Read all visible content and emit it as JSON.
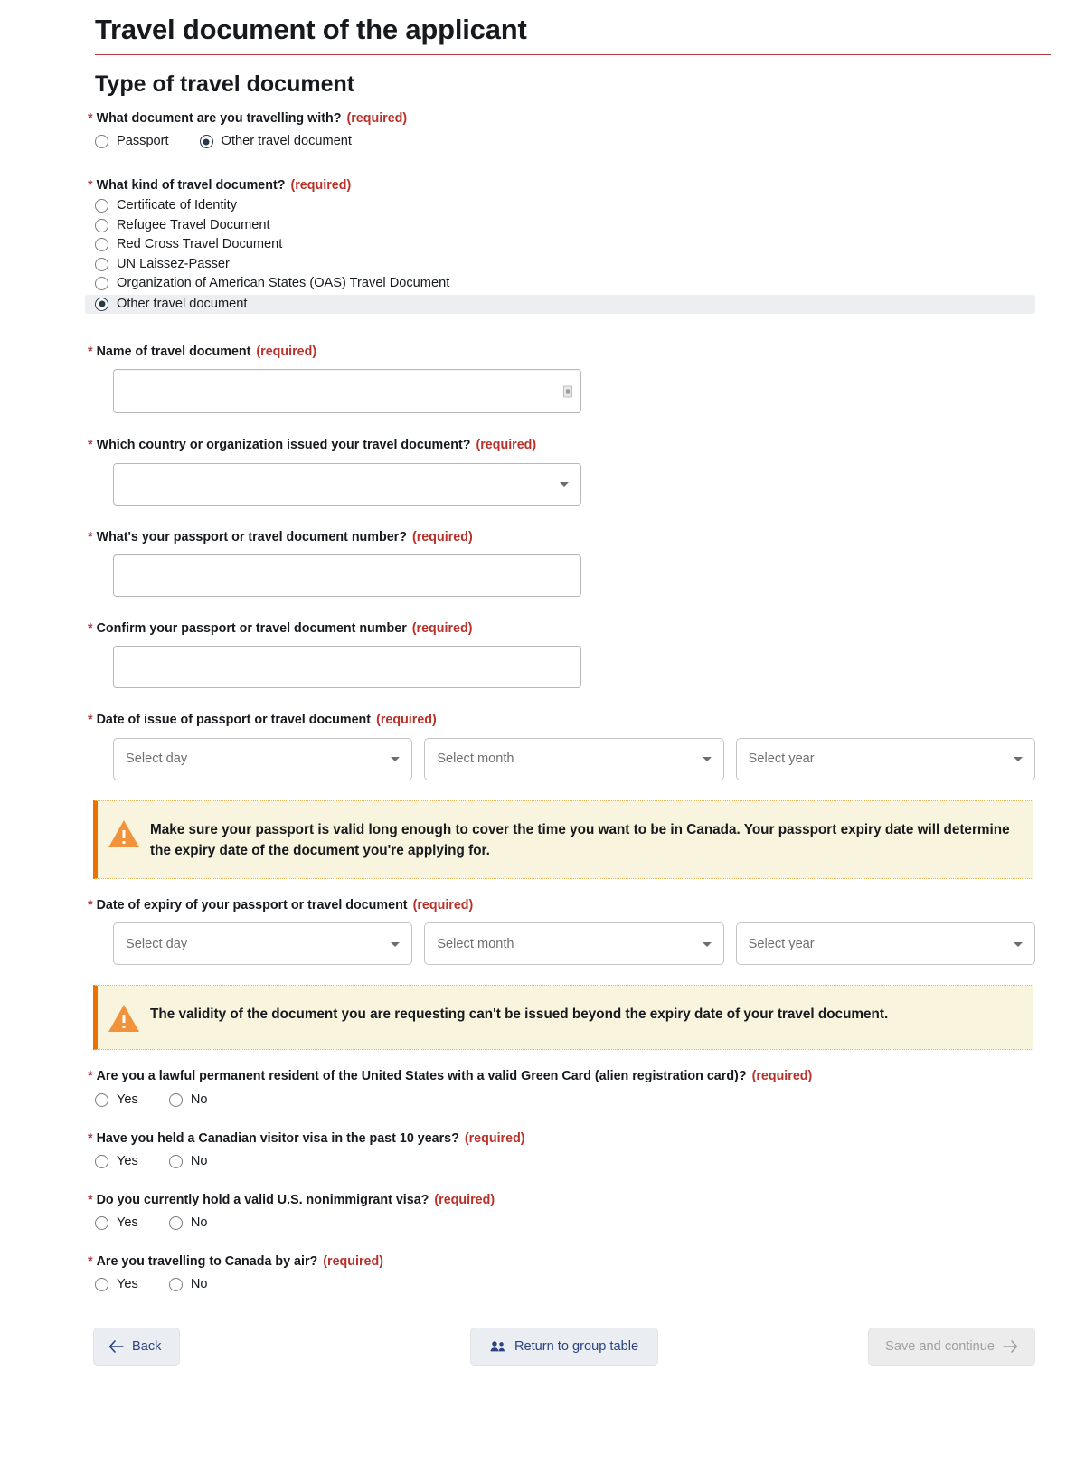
{
  "page": {
    "title": "Travel document of the applicant",
    "section_title": "Type of travel document",
    "required_tag": "(required)",
    "accent_color": "#af3c43",
    "required_color": "#b8322b",
    "alert_bg": "#f9f4dd",
    "alert_border": "#ee7100"
  },
  "q_doc_type": {
    "label": "What document are you travelling with?",
    "options": [
      {
        "label": "Passport",
        "checked": false
      },
      {
        "label": "Other travel document",
        "checked": true
      }
    ]
  },
  "q_doc_kind": {
    "label": "What kind of travel document?",
    "options": [
      {
        "label": "Certificate of Identity",
        "checked": false
      },
      {
        "label": "Refugee Travel Document",
        "checked": false
      },
      {
        "label": "Red Cross Travel Document",
        "checked": false
      },
      {
        "label": "UN Laissez-Passer",
        "checked": false
      },
      {
        "label": "Organization of American States (OAS) Travel Document",
        "checked": false
      },
      {
        "label": "Other travel document",
        "checked": true
      }
    ]
  },
  "q_doc_name": {
    "label": "Name of travel document",
    "value": "",
    "placeholder": ""
  },
  "q_issuer": {
    "label": "Which country or organization issued your travel document?",
    "selected": "",
    "placeholder": ""
  },
  "q_doc_number": {
    "label": "What's your passport or travel document number?",
    "value": "",
    "placeholder": ""
  },
  "q_doc_number_confirm": {
    "label": "Confirm your passport or travel document number",
    "value": "",
    "placeholder": ""
  },
  "q_date_issue": {
    "label": "Date of issue of passport or travel document",
    "day_placeholder": "Select day",
    "month_placeholder": "Select month",
    "year_placeholder": "Select year"
  },
  "alert_issue": {
    "text": "Make sure your passport is valid long enough to cover the time you want to be in Canada. Your passport expiry date will determine the expiry date of the document you're applying for."
  },
  "q_date_expiry": {
    "label": "Date of expiry of your passport or travel document",
    "day_placeholder": "Select day",
    "month_placeholder": "Select month",
    "year_placeholder": "Select year"
  },
  "alert_expiry": {
    "text": "The validity of the document you are requesting can't be issued beyond the expiry date of your travel document."
  },
  "q_green_card": {
    "label": "Are you a lawful permanent resident of the United States with a valid Green Card (alien registration card)?",
    "yes": "Yes",
    "no": "No"
  },
  "q_visitor_visa": {
    "label": "Have you held a Canadian visitor visa in the past 10 years?",
    "yes": "Yes",
    "no": "No"
  },
  "q_us_visa": {
    "label": "Do you currently hold a valid U.S. nonimmigrant visa?",
    "yes": "Yes",
    "no": "No"
  },
  "q_by_air": {
    "label": "Are you travelling to Canada by air?",
    "yes": "Yes",
    "no": "No"
  },
  "footer": {
    "back_label": "Back",
    "group_table_label": "Return to group table",
    "save_label": "Save and continue"
  }
}
